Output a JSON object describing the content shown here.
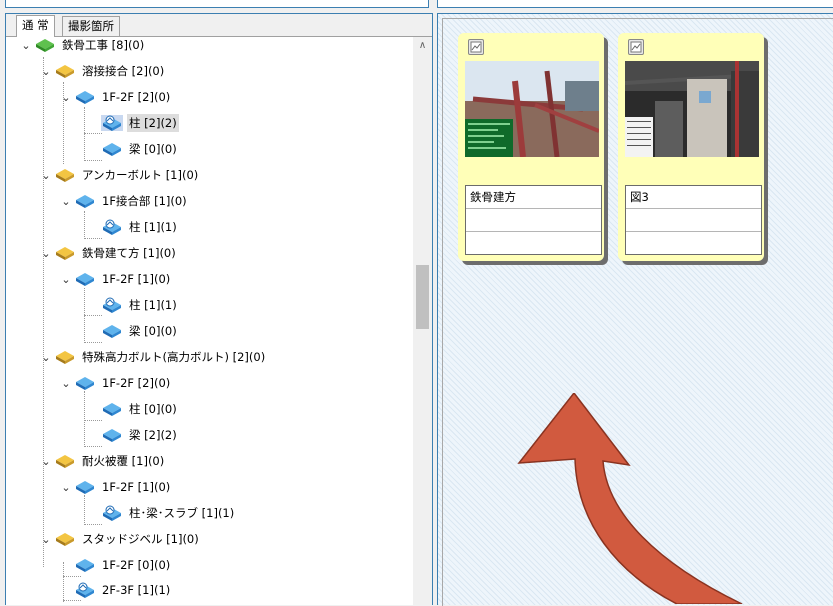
{
  "tabs": [
    {
      "label": "通 常"
    },
    {
      "label": "撮影箇所"
    }
  ],
  "tree": {
    "nodes": [
      {
        "label": "鉄骨工事 [8](0)",
        "icon": "folder-green-icon"
      },
      {
        "label": "溶接接合 [2](0)",
        "icon": "folder-yellow-icon"
      },
      {
        "label": "1F-2F [2](0)",
        "icon": "folder-blue-icon"
      },
      {
        "label": "柱 [2](2)",
        "icon": "folder-photo-icon"
      },
      {
        "label": "梁 [0](0)",
        "icon": "folder-blue-icon"
      },
      {
        "label": "アンカーボルト [1](0)",
        "icon": "folder-yellow-icon"
      },
      {
        "label": "1F接合部 [1](0)",
        "icon": "folder-blue-icon"
      },
      {
        "label": "柱 [1](1)",
        "icon": "folder-photo-icon"
      },
      {
        "label": "鉄骨建て方 [1](0)",
        "icon": "folder-yellow-icon"
      },
      {
        "label": "1F-2F [1](0)",
        "icon": "folder-blue-icon"
      },
      {
        "label": "柱 [1](1)",
        "icon": "folder-photo-icon"
      },
      {
        "label": "梁 [0](0)",
        "icon": "folder-blue-icon"
      },
      {
        "label": "特殊高力ボルト(高力ボルト) [2](0)",
        "icon": "folder-yellow-icon"
      },
      {
        "label": "1F-2F [2](0)",
        "icon": "folder-blue-icon"
      },
      {
        "label": "柱 [0](0)",
        "icon": "folder-blue-icon"
      },
      {
        "label": "梁 [2](2)",
        "icon": "folder-blue-icon"
      },
      {
        "label": "耐火被覆 [1](0)",
        "icon": "folder-yellow-icon"
      },
      {
        "label": "1F-2F [1](0)",
        "icon": "folder-blue-icon"
      },
      {
        "label": "柱･梁･スラブ [1](1)",
        "icon": "folder-photo-icon"
      },
      {
        "label": "スタッドジベル [1](0)",
        "icon": "folder-yellow-icon"
      },
      {
        "label": "1F-2F [0](0)",
        "icon": "folder-blue-icon"
      },
      {
        "label": "2F-3F [1](1)",
        "icon": "folder-photo-icon"
      }
    ]
  },
  "cards": [
    {
      "caption": "鉄骨建方",
      "check_icon": "image-check-icon"
    },
    {
      "caption": "図3",
      "check_icon": "image-check-icon"
    }
  ],
  "colors": {
    "card_bg": "#ffffb8",
    "arrow": "#d15a3f",
    "panel_border": "#3c7fb1"
  }
}
